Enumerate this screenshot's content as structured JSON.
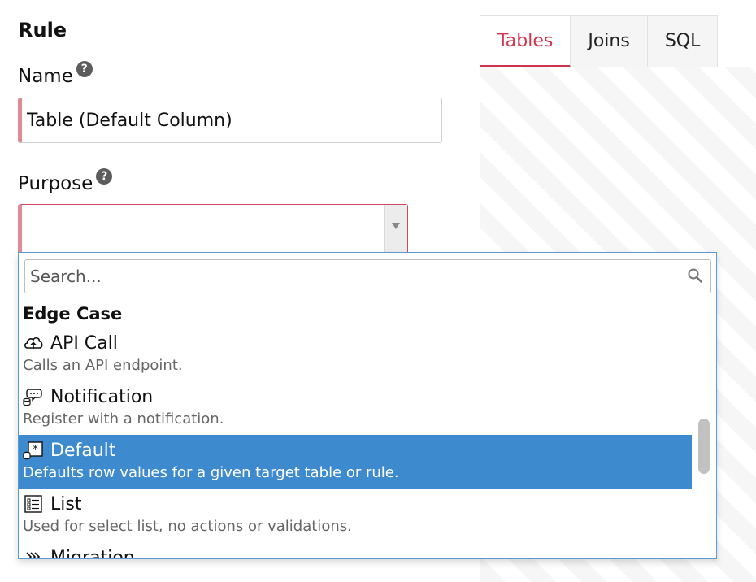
{
  "form": {
    "section_title": "Rule",
    "name_label": "Name",
    "name_value": "Table (Default Column)",
    "purpose_label": "Purpose",
    "purpose_value": "",
    "help_glyph": "?"
  },
  "tabs": [
    {
      "label": "Tables",
      "active": true
    },
    {
      "label": "Joins",
      "active": false
    },
    {
      "label": "SQL",
      "active": false
    }
  ],
  "dropdown": {
    "search_placeholder": "Search...",
    "search_value": "",
    "group_label": "Edge Case",
    "options": [
      {
        "icon": "cloud-upload-icon",
        "title": "API Call",
        "description": "Calls an API endpoint."
      },
      {
        "icon": "notification-icon",
        "title": "Notification",
        "description": "Register with a notification."
      },
      {
        "icon": "default-icon",
        "title": "Default",
        "description": "Defaults row values for a given target table or rule.",
        "highlighted": true
      },
      {
        "icon": "list-icon",
        "title": "List",
        "description": "Used for select list, no actions or validations."
      },
      {
        "icon": "migration-icon",
        "title": "Migration",
        "description": ""
      }
    ]
  },
  "colors": {
    "accent": "#d0344c",
    "highlight": "#3d8acf",
    "required_border": "#e08a96",
    "dropdown_border": "#5b9bd5"
  }
}
